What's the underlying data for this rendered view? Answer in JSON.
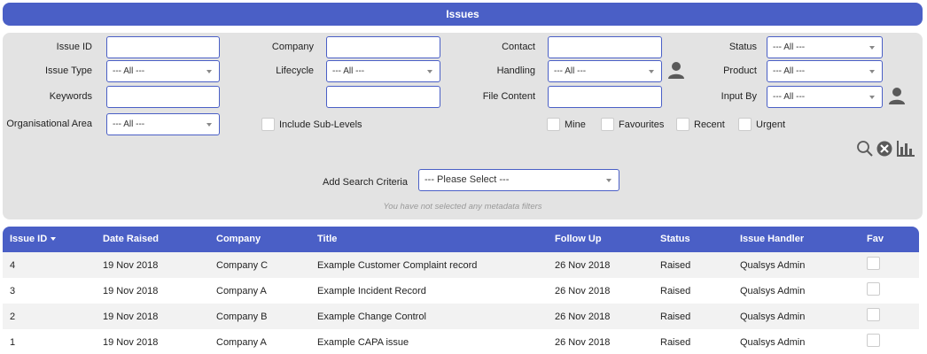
{
  "page": {
    "title": "Issues"
  },
  "filters": {
    "issue_id_label": "Issue ID",
    "issue_type_label": "Issue Type",
    "issue_type_value": "--- All ---",
    "keywords_label": "Keywords",
    "org_area_label": "Organisational Area",
    "org_area_value": "--- All ---",
    "company_label": "Company",
    "lifecycle_label": "Lifecycle",
    "lifecycle_value": "--- All ---",
    "include_sublevels_label": "Include Sub-Levels",
    "contact_label": "Contact",
    "handling_label": "Handling",
    "handling_value": "--- All ---",
    "file_content_label": "File Content",
    "status_label": "Status",
    "status_value": "--- All ---",
    "product_label": "Product",
    "product_value": "--- All ---",
    "input_by_label": "Input By",
    "input_by_value": "--- All ---",
    "mine_label": "Mine",
    "favourites_label": "Favourites",
    "recent_label": "Recent",
    "urgent_label": "Urgent",
    "add_criteria_label": "Add Search Criteria",
    "add_criteria_value": "--- Please Select ---",
    "metadata_hint": "You have not selected any metadata filters"
  },
  "icons": {
    "person": "user-icon",
    "search": "search-icon",
    "clear": "clear-icon",
    "chart": "bar-chart-icon",
    "accent": "#4a5fc6",
    "icon_color": "#5a5a5a"
  },
  "table": {
    "headers": [
      "Issue ID",
      "Date Raised",
      "Company",
      "Title",
      "Follow Up",
      "Status",
      "Issue Handler",
      "Fav"
    ],
    "rows": [
      {
        "id": "4",
        "date": "19 Nov 2018",
        "company": "Company C",
        "title": "Example Customer Complaint record",
        "follow_up": "26 Nov 2018",
        "status": "Raised",
        "handler": "Qualsys Admin"
      },
      {
        "id": "3",
        "date": "19 Nov 2018",
        "company": "Company A",
        "title": "Example Incident Record",
        "follow_up": "26 Nov 2018",
        "status": "Raised",
        "handler": "Qualsys Admin"
      },
      {
        "id": "2",
        "date": "19 Nov 2018",
        "company": "Company B",
        "title": "Example Change Control",
        "follow_up": "26 Nov 2018",
        "status": "Raised",
        "handler": "Qualsys Admin"
      },
      {
        "id": "1",
        "date": "19 Nov 2018",
        "company": "Company A",
        "title": "Example CAPA issue",
        "follow_up": "26 Nov 2018",
        "status": "Raised",
        "handler": "Qualsys Admin"
      }
    ]
  }
}
